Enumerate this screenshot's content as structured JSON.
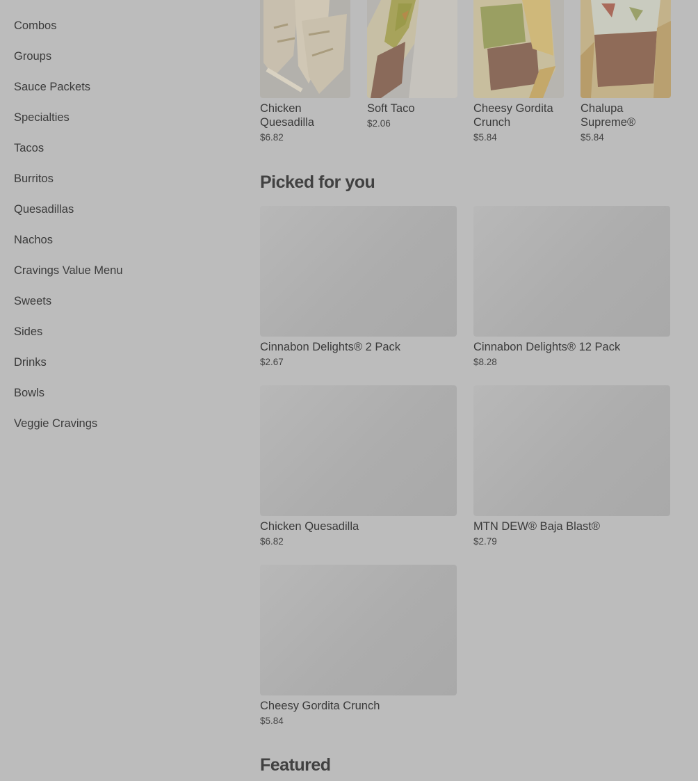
{
  "sidebar": {
    "items": [
      {
        "label": "Combos"
      },
      {
        "label": "Groups"
      },
      {
        "label": "Sauce Packets"
      },
      {
        "label": "Specialties"
      },
      {
        "label": "Tacos"
      },
      {
        "label": "Burritos"
      },
      {
        "label": "Quesadillas"
      },
      {
        "label": "Nachos"
      },
      {
        "label": "Cravings Value Menu"
      },
      {
        "label": "Sweets"
      },
      {
        "label": "Sides"
      },
      {
        "label": "Drinks"
      },
      {
        "label": "Bowls"
      },
      {
        "label": "Veggie Cravings"
      }
    ]
  },
  "top_row": {
    "items": [
      {
        "name": "Chicken Quesadilla",
        "price": "$6.82"
      },
      {
        "name": "Soft Taco",
        "price": "$2.06"
      },
      {
        "name": "Cheesy Gordita Crunch",
        "price": "$5.84"
      },
      {
        "name": "Chalupa Supreme®",
        "price": "$5.84"
      }
    ]
  },
  "picked": {
    "title": "Picked for you",
    "items": [
      {
        "name": "Cinnabon Delights® 2 Pack",
        "price": "$2.67"
      },
      {
        "name": "Cinnabon Delights® 12 Pack",
        "price": "$8.28"
      },
      {
        "name": "Chicken Quesadilla",
        "price": "$6.82"
      },
      {
        "name": "MTN DEW® Baja Blast®",
        "price": "$2.79"
      },
      {
        "name": "Cheesy Gordita Crunch",
        "price": "$5.84"
      }
    ]
  },
  "featured": {
    "title": "Featured"
  }
}
